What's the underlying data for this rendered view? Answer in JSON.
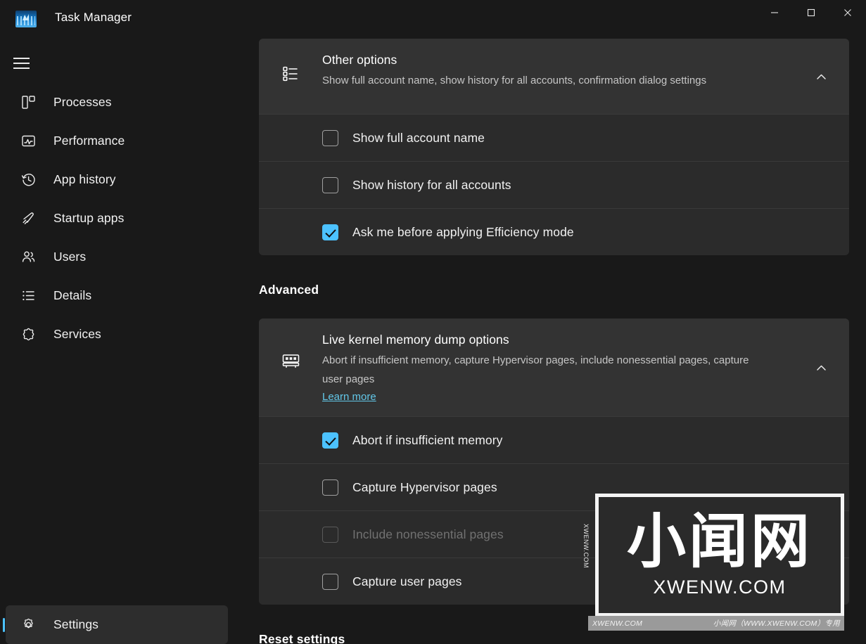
{
  "window": {
    "title": "Task Manager",
    "app_icon": "task-manager-icon",
    "controls": {
      "minimize": "–",
      "maximize": "□",
      "close": "✕"
    }
  },
  "sidebar": {
    "menu_icon": "hamburger-icon",
    "items": [
      {
        "label": "Processes",
        "icon": "processes-icon"
      },
      {
        "label": "Performance",
        "icon": "performance-icon"
      },
      {
        "label": "App history",
        "icon": "history-clock-icon"
      },
      {
        "label": "Startup apps",
        "icon": "startup-rocket-icon"
      },
      {
        "label": "Users",
        "icon": "users-icon"
      },
      {
        "label": "Details",
        "icon": "details-list-icon"
      },
      {
        "label": "Services",
        "icon": "services-gear-icon"
      }
    ],
    "footer": {
      "label": "Settings",
      "icon": "gear-icon",
      "selected": true
    }
  },
  "main": {
    "other_options": {
      "icon": "bulleted-list-icon",
      "title": "Other options",
      "description": "Show full account name, show history for all accounts, confirmation dialog settings",
      "chevron": "chevron-up-icon",
      "rows": [
        {
          "label": "Show full account name",
          "checked": false,
          "disabled": false
        },
        {
          "label": "Show history for all accounts",
          "checked": false,
          "disabled": false
        },
        {
          "label": "Ask me before applying Efficiency mode",
          "checked": true,
          "disabled": false
        }
      ]
    },
    "advanced_heading": "Advanced",
    "live_kernel": {
      "icon": "memory-ram-icon",
      "title": "Live kernel memory dump options",
      "description": "Abort if insufficient memory, capture Hypervisor pages, include nonessential pages, capture user pages",
      "link": "Learn more",
      "chevron": "chevron-up-icon",
      "rows": [
        {
          "label": "Abort if insufficient memory",
          "checked": true,
          "disabled": false
        },
        {
          "label": "Capture Hypervisor pages",
          "checked": false,
          "disabled": false
        },
        {
          "label": "Include nonessential pages",
          "checked": false,
          "disabled": true
        },
        {
          "label": "Capture user pages",
          "checked": false,
          "disabled": false
        }
      ]
    },
    "reset_heading": "Reset settings"
  },
  "watermark": {
    "cjk": "小闻网",
    "domain": "XWENW.COM",
    "side_text": "XWENW.COM",
    "footer_left": "XWENW.COM",
    "footer_right": "小闻网（WWW.XWENW.COM）专用"
  },
  "colors": {
    "accent": "#4cc2ff",
    "window_bg": "#191919",
    "card_bg": "#2b2b2b",
    "card_header_bg": "#333333",
    "link": "#62c7e8"
  }
}
